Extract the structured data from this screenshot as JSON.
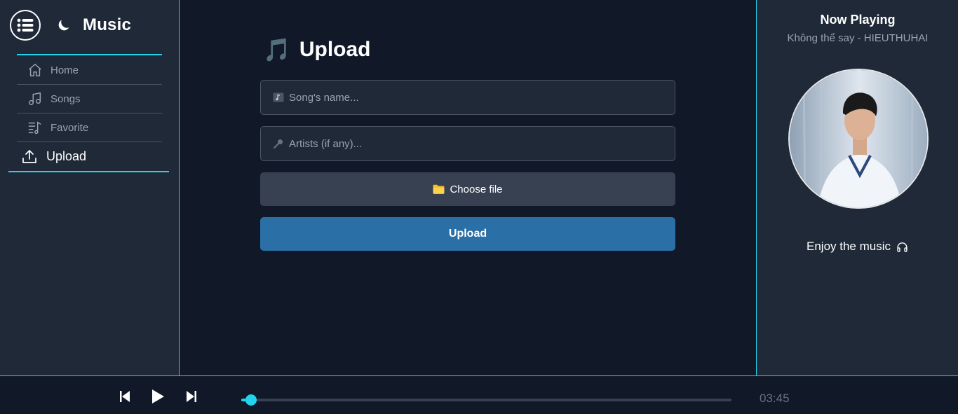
{
  "app": {
    "title": "Music"
  },
  "sidebar": {
    "items": [
      {
        "label": "Home",
        "icon": "home-icon"
      },
      {
        "label": "Songs",
        "icon": "music-note-icon"
      },
      {
        "label": "Favorite",
        "icon": "playlist-icon"
      }
    ],
    "active": {
      "label": "Upload",
      "icon": "upload-icon"
    }
  },
  "upload": {
    "title": "Upload",
    "title_icon": "🎵",
    "song_placeholder": "Song's name...",
    "artist_placeholder": "Artists (if any)...",
    "choose_label": "Choose file",
    "submit_label": "Upload"
  },
  "now_playing": {
    "title": "Now Playing",
    "song": "Không thể say - HIEUTHUHAI",
    "enjoy": "Enjoy the music"
  },
  "player": {
    "time": "03:45",
    "progress": 0.02
  },
  "colors": {
    "accent": "#22d3ee",
    "sidebar_bg": "#1f2937",
    "main_bg": "#111827",
    "upload_button": "#2a6fa5"
  }
}
